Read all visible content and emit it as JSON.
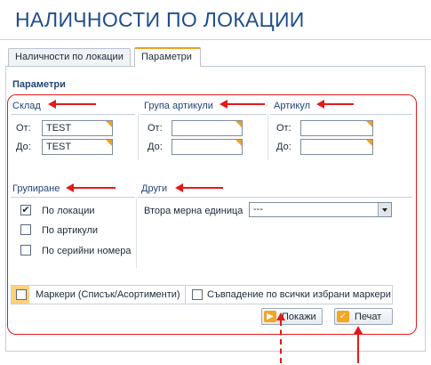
{
  "page_title": "НАЛИЧНОСТИ ПО ЛОКАЦИИ",
  "tabs": [
    {
      "label": "Наличности по локации",
      "active": false
    },
    {
      "label": "Параметри",
      "active": true
    }
  ],
  "section_title": "Параметри",
  "groups": {
    "warehouse": {
      "label": "Склад",
      "from_label": "От:",
      "to_label": "До:",
      "from_value": "TEST",
      "to_value": "TEST"
    },
    "item_group": {
      "label": "Група артикули",
      "from_label": "От:",
      "to_label": "До:",
      "from_value": "",
      "to_value": ""
    },
    "item": {
      "label": "Артикул",
      "from_label": "От:",
      "to_label": "До:",
      "from_value": "",
      "to_value": ""
    }
  },
  "grouping": {
    "label": "Групиране",
    "options": [
      {
        "label": "По локации",
        "checked": true
      },
      {
        "label": "По артикули",
        "checked": false
      },
      {
        "label": "По серийни номера",
        "checked": false
      }
    ]
  },
  "other": {
    "label": "Други",
    "second_unit_label": "Втора мерна единица",
    "second_unit_value": "---"
  },
  "markers": {
    "label": "Маркери (Списък/Асортименти)",
    "checked": false,
    "match_all_label": "Съвпадение по всички избрани маркери",
    "match_all_checked": false
  },
  "buttons": {
    "show": "Покажи",
    "print": "Печат"
  },
  "colors": {
    "title": "#1e4f8c",
    "annotation_red": "#e4191b",
    "accent_orange": "#f0a020"
  }
}
